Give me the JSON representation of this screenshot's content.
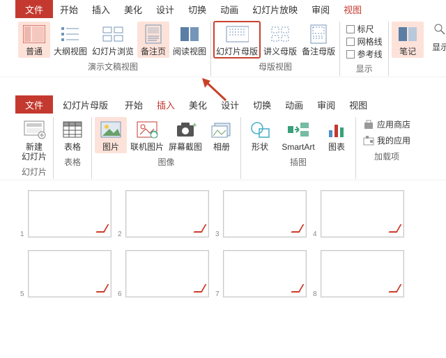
{
  "colors": {
    "accent": "#c4392f",
    "highlight_bg": "#fde2d9",
    "callout_outline": "#c8412b"
  },
  "ribbon1": {
    "tabs": {
      "file": "文件",
      "start": "开始",
      "insert": "插入",
      "beautify": "美化",
      "design": "设计",
      "transition": "切换",
      "animation": "动画",
      "slideshow": "幻灯片放映",
      "review": "审阅",
      "view": "视图"
    },
    "active_tab": "view",
    "groups": {
      "presentation_views": {
        "label": "演示文稿视图",
        "normal": "普通",
        "outline": "大纲视图",
        "sorter": "幻灯片浏览",
        "notes_page": "备注页",
        "reading": "阅读视图"
      },
      "master_views": {
        "label": "母版视图",
        "slide_master": "幻灯片母版",
        "handout_master": "讲义母版",
        "notes_master": "备注母版"
      },
      "show": {
        "label": "显示",
        "ruler": "标尺",
        "gridlines": "网格线",
        "guides": "参考线"
      },
      "notes": {
        "label": "笔记"
      },
      "show_presenter": {
        "label": "显示"
      }
    }
  },
  "ribbon2": {
    "tabs": {
      "file": "文件",
      "slide_master": "幻灯片母版",
      "start": "开始",
      "insert": "插入",
      "beautify": "美化",
      "design": "设计",
      "transition": "切换",
      "animation": "动画",
      "review": "审阅",
      "view": "视图"
    },
    "active_tab": "insert",
    "groups": {
      "slides": {
        "label": "幻灯片",
        "new_slide": "新建\n幻灯片"
      },
      "tables": {
        "label": "表格",
        "table": "表格"
      },
      "images": {
        "label": "图像",
        "pictures": "图片",
        "online_pictures": "联机图片",
        "screenshot": "屏幕截图",
        "photo_album": "相册"
      },
      "illustrations": {
        "label": "插图",
        "shapes": "形状",
        "smartart": "SmartArt",
        "chart": "图表"
      },
      "addins": {
        "label": "加载项",
        "store": "应用商店",
        "my_addins": "我的应用"
      }
    }
  },
  "slides": {
    "count": 8,
    "numbers": [
      "1",
      "2",
      "3",
      "4",
      "5",
      "6",
      "7",
      "8"
    ]
  }
}
